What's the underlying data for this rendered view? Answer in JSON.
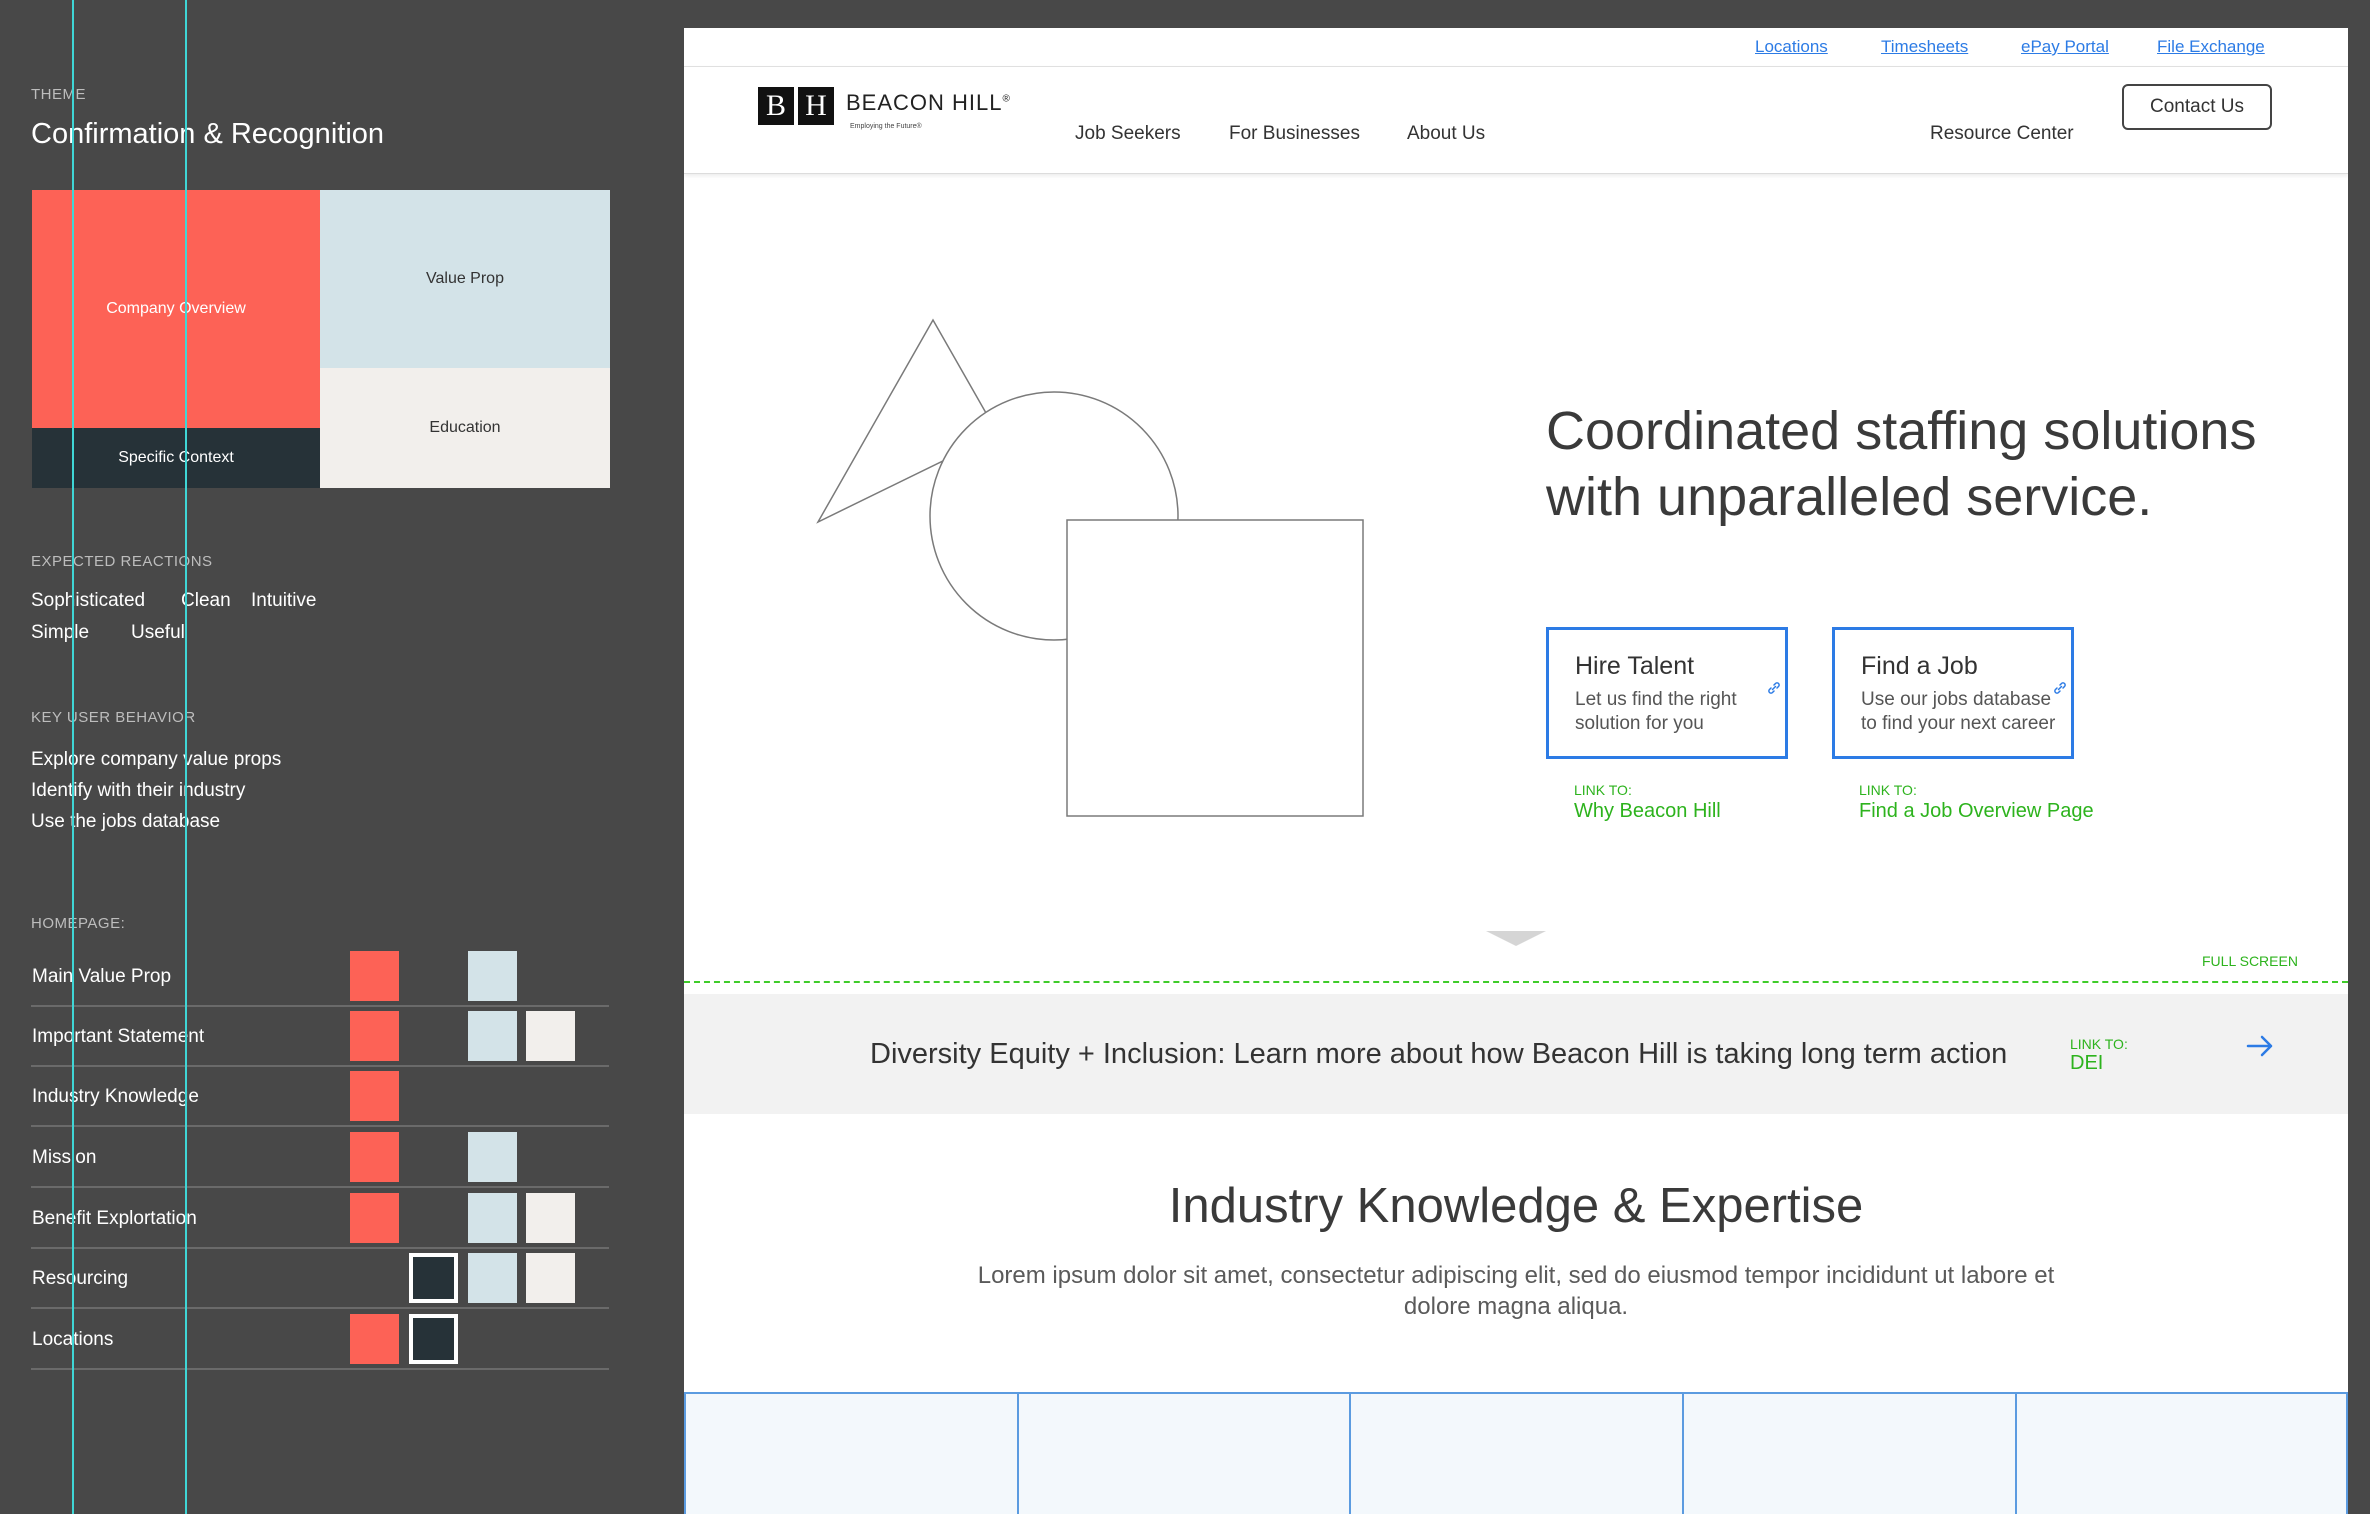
{
  "panel": {
    "theme_label": "THEME",
    "theme_title": "Confirmation & Recognition",
    "theme_blocks": {
      "company_overview": "Company Overview",
      "specific_context": "Specific Context",
      "value_prop": "Value Prop",
      "education": "Education"
    },
    "reactions_label": "EXPECTED REACTIONS",
    "reactions": [
      "Sophisticated",
      "Clean",
      "Intuitive",
      "Simple",
      "Useful"
    ],
    "behavior_label": "KEY USER BEHAVIOR",
    "behaviors": [
      "Explore company value props",
      "Identify with their industry",
      "Use the jobs database"
    ],
    "homepage_label": "HOMEPAGE:",
    "homepage_rows": [
      {
        "label": "Main Value Prop",
        "swatches": [
          "red",
          "",
          "blue",
          ""
        ]
      },
      {
        "label": "Important Statement",
        "swatches": [
          "red",
          "",
          "blue",
          "cream"
        ]
      },
      {
        "label": "Industry Knowledge",
        "swatches": [
          "red",
          "",
          "",
          ""
        ]
      },
      {
        "label": "Mission",
        "swatches": [
          "red",
          "",
          "blue",
          ""
        ]
      },
      {
        "label": "Benefit Explortation",
        "swatches": [
          "red",
          "",
          "blue",
          "cream"
        ]
      },
      {
        "label": "Resourcing",
        "swatches": [
          "",
          "dark",
          "blue",
          "cream"
        ]
      },
      {
        "label": "Locations",
        "swatches": [
          "red",
          "dark",
          "",
          ""
        ]
      }
    ],
    "colors": {
      "red": "#fd6256",
      "blue": "#d3e3e8",
      "cream": "#f2efec",
      "dark": "#263238",
      "guide": "#3fd6d6"
    }
  },
  "utility_links": [
    "Locations",
    "Timesheets",
    "ePay Portal",
    "File Exchange"
  ],
  "logo": {
    "mark_b": "B",
    "mark_h": "H",
    "name": "BEACON HILL",
    "reg": "®",
    "tagline": "Employing the Future®"
  },
  "nav": {
    "job_seekers": "Job Seekers",
    "for_businesses": "For Businesses",
    "about_us": "About Us",
    "resource_center": "Resource Center",
    "contact_us": "Contact Us"
  },
  "hero": {
    "title": "Coordinated staffing solutions with unparalleled service.",
    "cta_hire": {
      "title": "Hire Talent",
      "desc": "Let us find the right solution for you",
      "icon": "link-icon"
    },
    "cta_find": {
      "title": "Find a Job",
      "desc": "Use our jobs database to find your next career",
      "icon": "link-icon"
    },
    "link_hire": {
      "key": "LINK TO:",
      "value": "Why Beacon Hill"
    },
    "link_find": {
      "key": "LINK TO:",
      "value": "Find a Job Overview Page"
    }
  },
  "fold": {
    "label": "FULL SCREEN"
  },
  "dei": {
    "text": "Diversity Equity + Inclusion: Learn more about how Beacon Hill is taking long term action",
    "link_key": "LINK TO:",
    "link_value": "DEI",
    "icon": "arrow-right-icon"
  },
  "industry": {
    "title": "Industry Knowledge & Expertise",
    "body": "Lorem ipsum dolor sit amet, consectetur adipiscing elit, sed do eiusmod tempor incididunt ut labore et dolore magna aliqua."
  },
  "accent": {
    "link_blue": "#2c7be5",
    "annotation_green": "#2db31d"
  }
}
